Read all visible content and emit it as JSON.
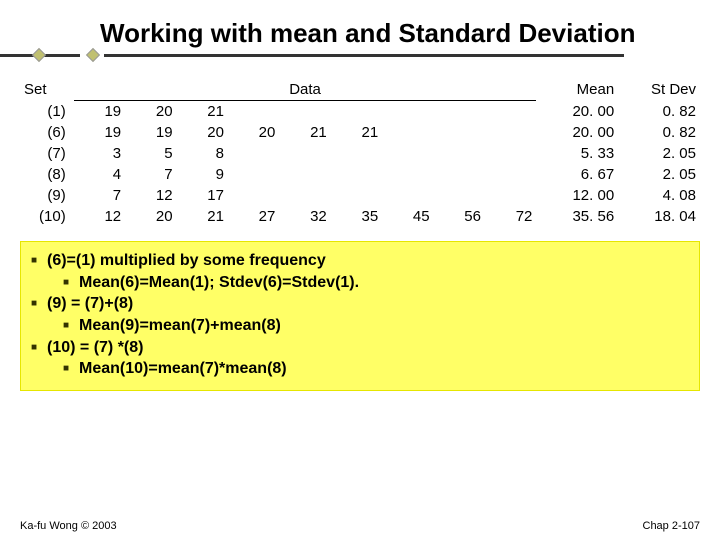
{
  "title": "Working with mean and Standard Deviation",
  "columns": {
    "set": "Set",
    "data": "Data",
    "mean": "Mean",
    "stdev": "St Dev"
  },
  "chart_data": {
    "type": "table",
    "rows": [
      {
        "set": "(1)",
        "data": [
          19,
          20,
          21
        ],
        "mean": "20. 00",
        "stdev": "0. 82"
      },
      {
        "set": "(6)",
        "data": [
          19,
          19,
          20,
          20,
          21,
          21
        ],
        "mean": "20. 00",
        "stdev": "0. 82"
      },
      {
        "set": "(7)",
        "data": [
          3,
          5,
          8
        ],
        "mean": "5. 33",
        "stdev": "2. 05"
      },
      {
        "set": "(8)",
        "data": [
          4,
          7,
          9
        ],
        "mean": "6. 67",
        "stdev": "2. 05"
      },
      {
        "set": "(9)",
        "data": [
          7,
          12,
          17
        ],
        "mean": "12. 00",
        "stdev": "4. 08"
      },
      {
        "set": "(10)",
        "data": [
          12,
          20,
          21,
          27,
          32,
          35,
          45,
          56,
          72
        ],
        "mean": "35. 56",
        "stdev": "18. 04"
      }
    ]
  },
  "notes": [
    {
      "text": "(6)=(1) multiplied by some frequency",
      "sub": "Mean(6)=Mean(1); Stdev(6)=Stdev(1)."
    },
    {
      "text": "(9) = (7)+(8)",
      "sub": "Mean(9)=mean(7)+mean(8)"
    },
    {
      "text": "(10) = (7) *(8)",
      "sub": "Mean(10)=mean(7)*mean(8)"
    }
  ],
  "footer": {
    "left": "Ka-fu Wong © 2003",
    "right": "Chap 2-107"
  }
}
